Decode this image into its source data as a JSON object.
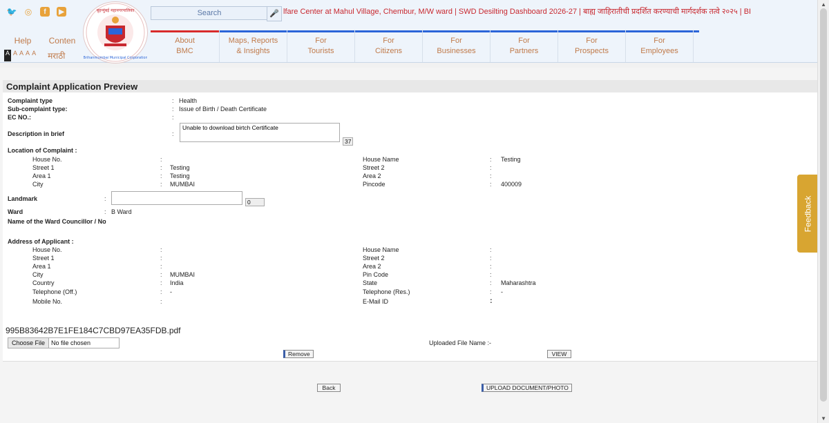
{
  "header": {
    "social_icons": [
      "twitter-icon",
      "instagram-icon",
      "facebook-icon",
      "youtube-icon"
    ],
    "help_label": "Help",
    "content_label": "Conten",
    "marathi_label": "मराठी",
    "font_sizes": [
      "A",
      "A",
      "A",
      "A",
      "A"
    ],
    "search_placeholder": "Search",
    "ticker": "lfare Center at Mahul Village, Chembur, M/W ward | SWD Desilting Dashboard 2026-27 | बाह्य जाहिरातीची प्रदर्शित करण्याची मार्गदर्शक तत्वे २०२५ | BI",
    "logo_text": "बृहन्मुंबई महानगरपालिका Brihanmumbai Municipal Corporation"
  },
  "nav": [
    {
      "line1": "About",
      "line2": "BMC"
    },
    {
      "line1": "Maps, Reports",
      "line2": "& Insights"
    },
    {
      "line1": "For",
      "line2": "Tourists"
    },
    {
      "line1": "For",
      "line2": "Citizens"
    },
    {
      "line1": "For",
      "line2": "Businesses"
    },
    {
      "line1": "For",
      "line2": "Partners"
    },
    {
      "line1": "For",
      "line2": "Prospects"
    },
    {
      "line1": "For",
      "line2": "Employees"
    }
  ],
  "form": {
    "title": "Complaint Application Preview",
    "complaint_type_label": "Complaint type",
    "complaint_type": "Health",
    "sub_complaint_label": "Sub-complaint type:",
    "sub_complaint": "Issue of Birth / Death Certificate",
    "ec_no_label": "EC NO.:",
    "description_label": "Description in brief",
    "description": "Unable to download birtch Certificate",
    "description_count": "37",
    "location_label": "Location of Complaint :",
    "loc": {
      "house_no_label": "House No.",
      "house_no": "",
      "street1_label": "Street 1",
      "street1": "Testing",
      "area1_label": "Area 1",
      "area1": "Testing",
      "city_label": "City",
      "city": "MUMBAI",
      "house_name_label": "House Name",
      "house_name": "Testing",
      "street2_label": "Street 2",
      "street2": "",
      "area2_label": "Area 2",
      "area2": "",
      "pincode_label": "Pincode",
      "pincode": "400009"
    },
    "landmark_label": "Landmark",
    "landmark_count": "0",
    "ward_label": "Ward",
    "ward": "B Ward",
    "councillor_label": "Name of the Ward Councillor / No",
    "applicant_label": "Address of Applicant :",
    "app": {
      "house_no_label": "House No.",
      "house_no": "",
      "street1_label": "Street 1",
      "street1": "",
      "area1_label": "Area 1",
      "area1": "",
      "city_label": "City",
      "city": "MUMBAI",
      "country_label": "Country",
      "country": "India",
      "tel_off_label": "Telephone (Off.)",
      "tel_off": "-",
      "mobile_label": "Mobile No.",
      "mobile": "",
      "house_name_label": "House Name",
      "house_name": "",
      "street2_label": "Street 2",
      "street2": "",
      "area2_label": "Area 2",
      "area2": "",
      "pin_label": "Pin Code",
      "pin": "",
      "state_label": "State",
      "state": "Maharashtra",
      "tel_res_label": "Telephone (Res.)",
      "tel_res": "-",
      "email_label": "E-Mail ID",
      "email": ""
    },
    "pdf_name": "995B83642B7E1FE184C7CBD97EA35FDB.pdf",
    "choose_file": "Choose File",
    "no_file": "No file chosen",
    "uploaded_file_label": "Uploaded File Name :-",
    "remove_btn": "Remove",
    "view_btn": "VIEW",
    "back_btn": "Back",
    "upload_btn": "UPLOAD DOCUMENT/PHOTO"
  },
  "feedback_label": "Feedback"
}
